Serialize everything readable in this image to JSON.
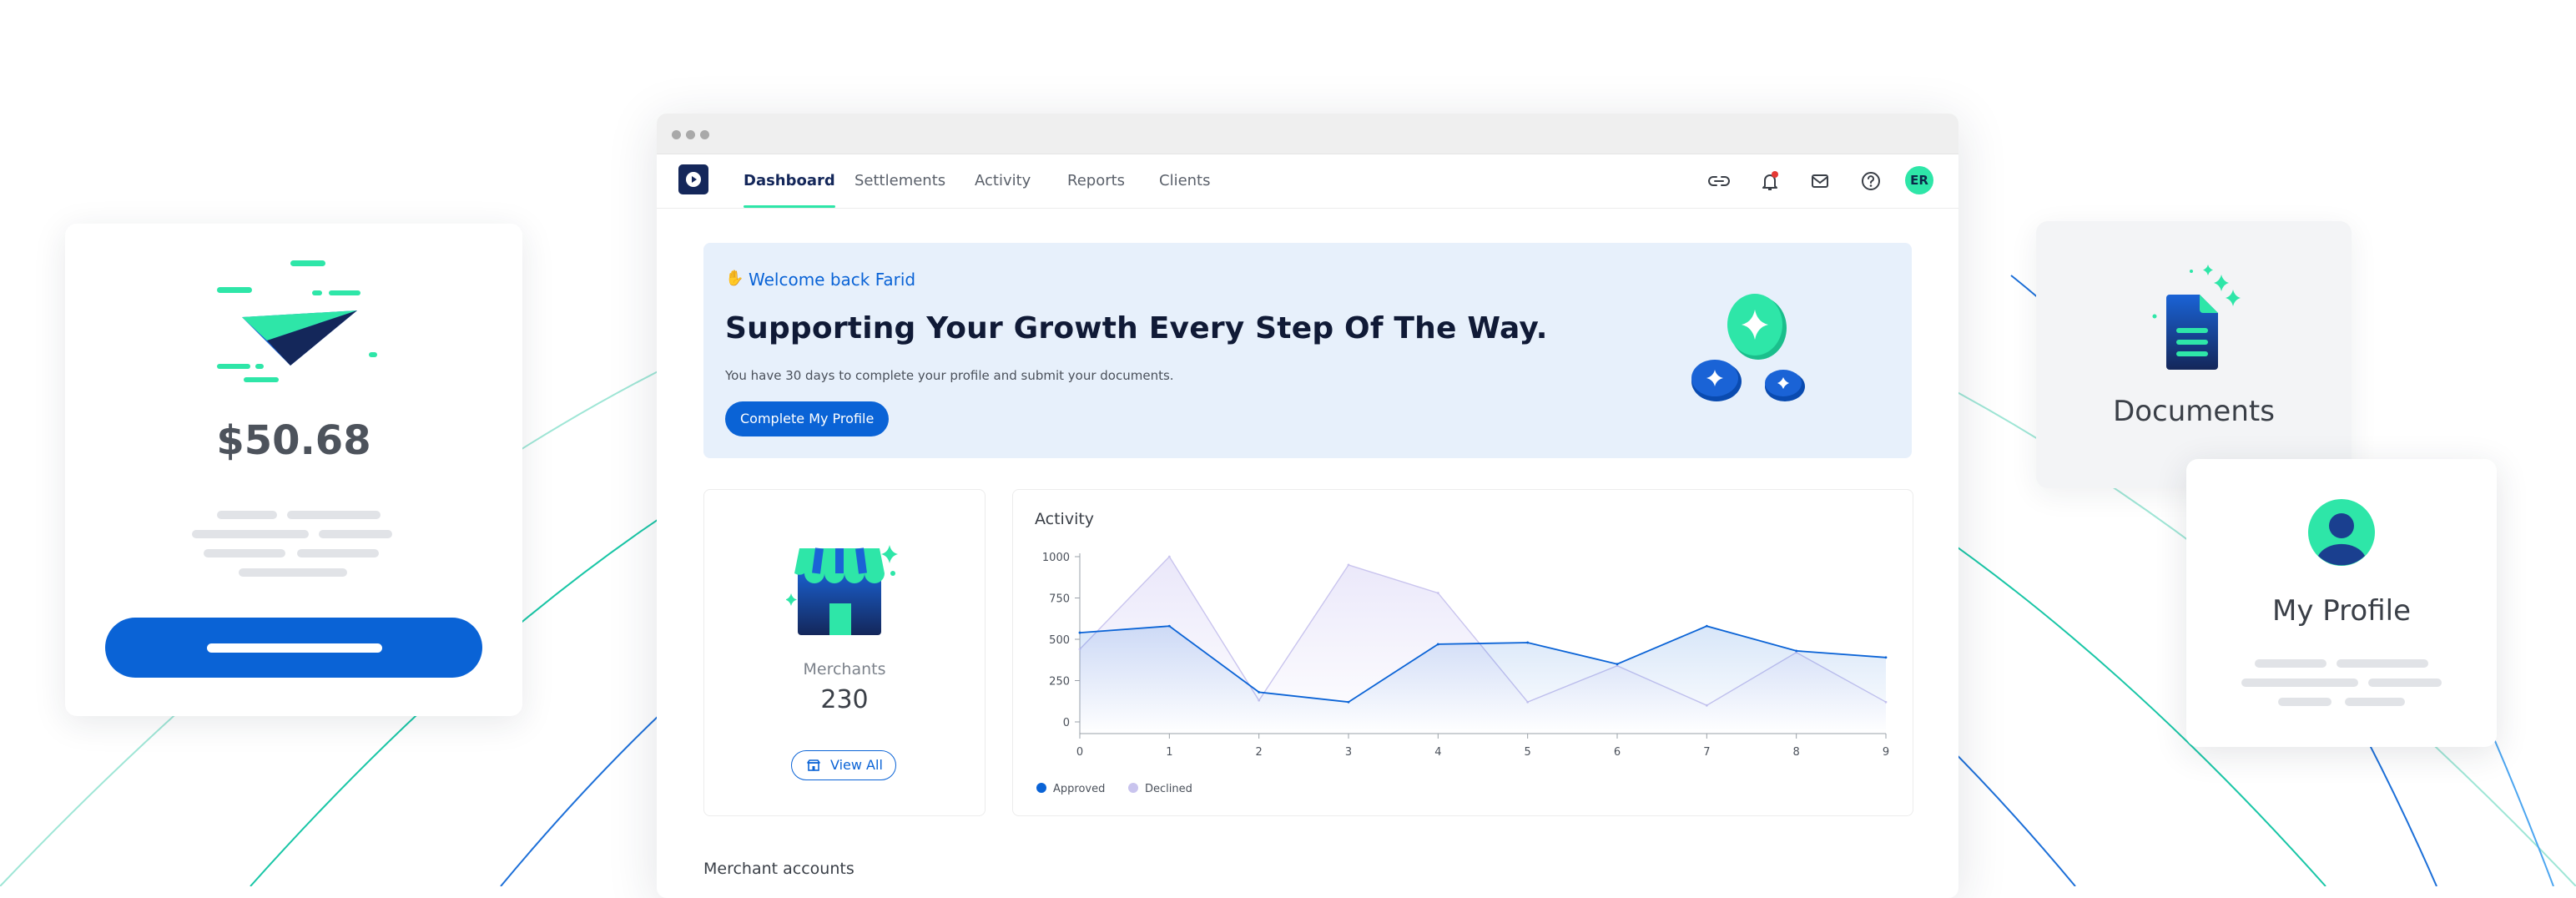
{
  "colors": {
    "brand_blue": "#0a63d6",
    "accent_green": "#2ee6a8",
    "navy": "#14275a",
    "approved": "#0a63d6",
    "declined": "#c9c4ee",
    "banner_bg": "#e7f0fb"
  },
  "payment_card": {
    "icon": "paper-plane-icon",
    "amount": "$50.68"
  },
  "documents_card": {
    "icon": "document-icon",
    "title": "Documents"
  },
  "profile_card": {
    "icon": "user-icon",
    "title": "My Profile"
  },
  "app": {
    "nav": {
      "tabs": [
        {
          "label": "Dashboard",
          "active": true
        },
        {
          "label": "Settlements"
        },
        {
          "label": "Activity"
        },
        {
          "label": "Reports"
        },
        {
          "label": "Clients"
        }
      ],
      "icons": [
        "link-icon",
        "bell-icon",
        "mail-icon",
        "help-icon"
      ],
      "avatar_initials": "ER"
    },
    "welcome": {
      "greeting_icon": "wave-hand-icon",
      "label": "Welcome back Farid",
      "title": "Supporting Your Growth Every Step Of The Way.",
      "subtitle": "You have 30 days to complete your profile and submit your documents.",
      "button": "Complete My Profile"
    },
    "merchants": {
      "icon": "storefront-icon",
      "label": "Merchants",
      "count": "230",
      "button": "View All"
    },
    "activity": {
      "title": "Activity"
    },
    "merchant_accounts": {
      "title": "Merchant accounts"
    }
  },
  "chart_data": {
    "type": "area",
    "title": "Activity",
    "x": [
      0,
      1,
      2,
      3,
      4,
      5,
      6,
      7,
      8,
      9
    ],
    "series": [
      {
        "name": "Approved",
        "values": [
          540,
          580,
          180,
          120,
          470,
          480,
          350,
          580,
          430,
          390
        ]
      },
      {
        "name": "Declined",
        "values": [
          440,
          1000,
          130,
          950,
          780,
          120,
          340,
          100,
          420,
          120
        ]
      }
    ],
    "y_ticks": [
      0,
      250,
      500,
      750,
      1000
    ],
    "ylim": [
      0,
      1000
    ],
    "xlim": [
      0,
      9
    ],
    "grid": false,
    "legend": "bottom-left"
  }
}
